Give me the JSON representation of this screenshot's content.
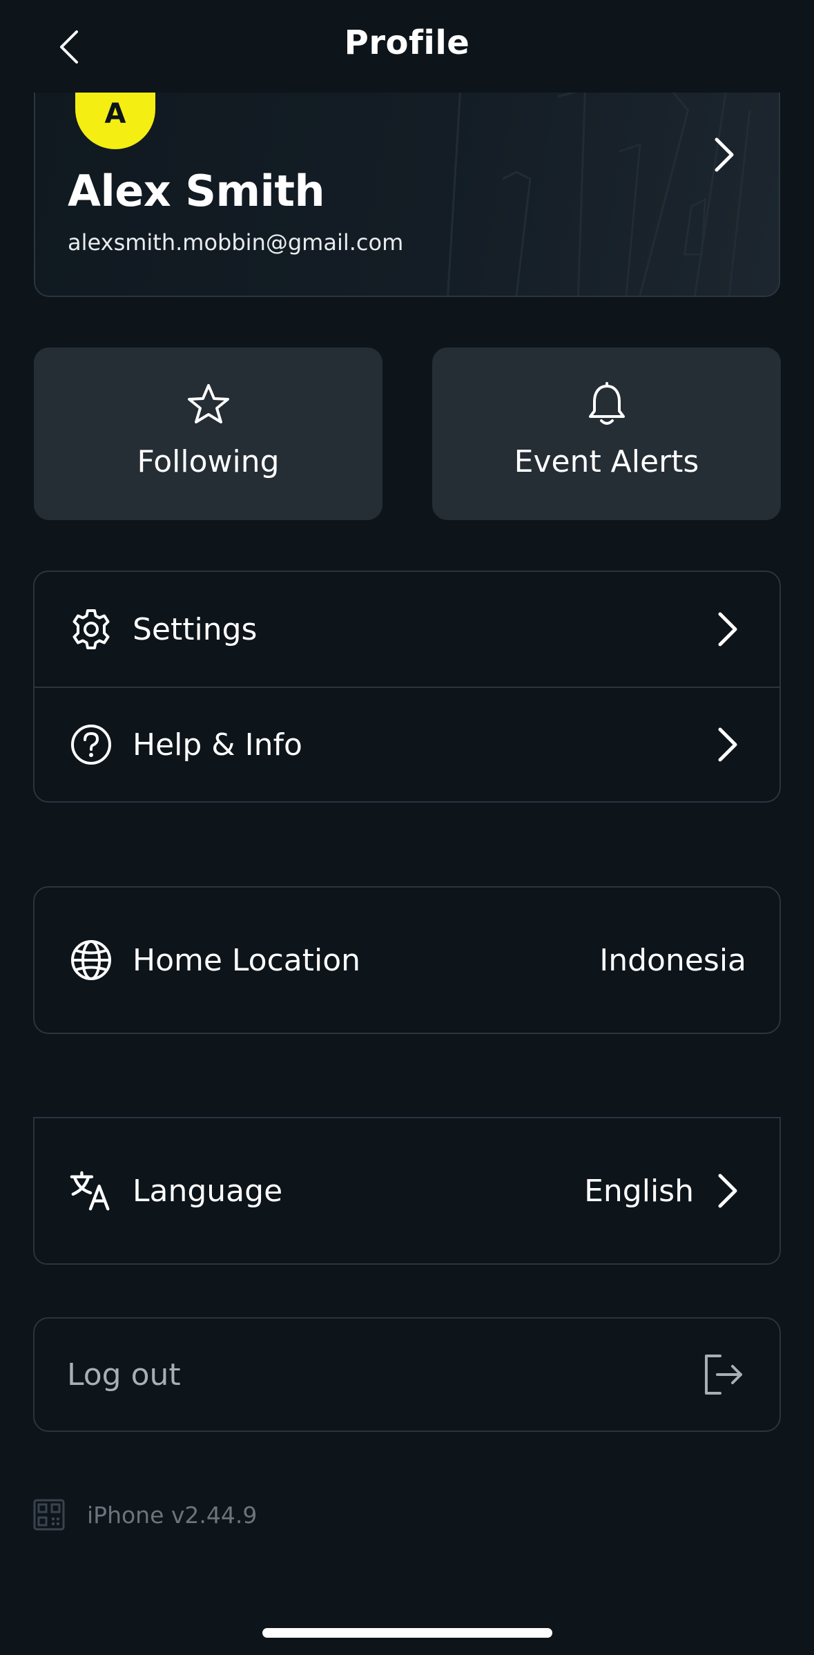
{
  "header": {
    "title": "Profile",
    "back_icon": "chevron-left-icon"
  },
  "profile": {
    "avatar_initial": "A",
    "avatar_color": "#f4ee12",
    "name": "Alex Smith",
    "email": "alexsmith.mobbin@gmail.com"
  },
  "tiles": [
    {
      "label": "Following",
      "icon": "star-icon"
    },
    {
      "label": "Event Alerts",
      "icon": "bell-icon"
    }
  ],
  "menu": {
    "settings_label": "Settings",
    "help_label": "Help & Info"
  },
  "location": {
    "label": "Home Location",
    "value": "Indonesia"
  },
  "language": {
    "label": "Language",
    "value": "English"
  },
  "logout": {
    "label": "Log out"
  },
  "footer": {
    "version": "iPhone v2.44.9"
  },
  "colors": {
    "background": "#0d141a",
    "tile": "#252d35",
    "border": "#2b3540",
    "accent": "#f4ee12",
    "muted_text": "#a8b0b7"
  }
}
